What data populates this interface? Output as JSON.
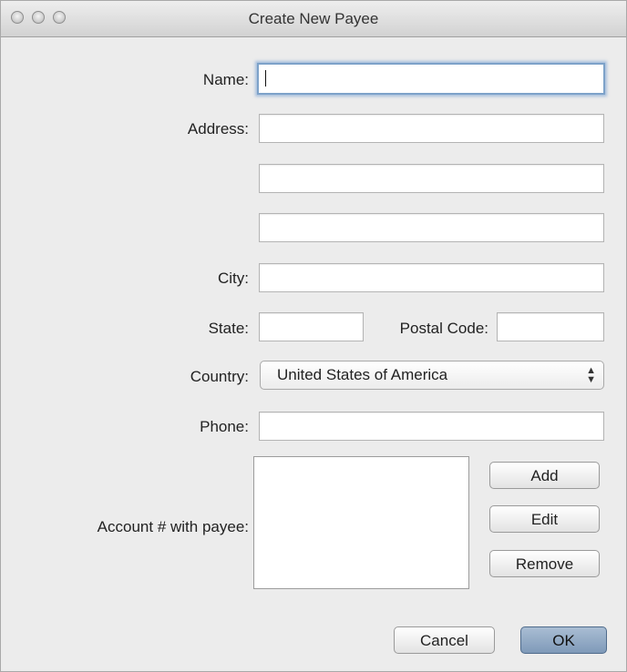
{
  "window": {
    "title": "Create New Payee"
  },
  "form": {
    "name_label": "Name:",
    "name_value": "",
    "address_label": "Address:",
    "address_line1": "",
    "address_line2": "",
    "address_line3": "",
    "city_label": "City:",
    "city_value": "",
    "state_label": "State:",
    "state_value": "",
    "postal_label": "Postal Code:",
    "postal_value": "",
    "country_label": "Country:",
    "country_value": "United States of America",
    "phone_label": "Phone:",
    "phone_value": "",
    "account_label": "Account # with payee:",
    "account_items": []
  },
  "buttons": {
    "add": "Add",
    "edit": "Edit",
    "remove": "Remove",
    "cancel": "Cancel",
    "ok": "OK"
  }
}
